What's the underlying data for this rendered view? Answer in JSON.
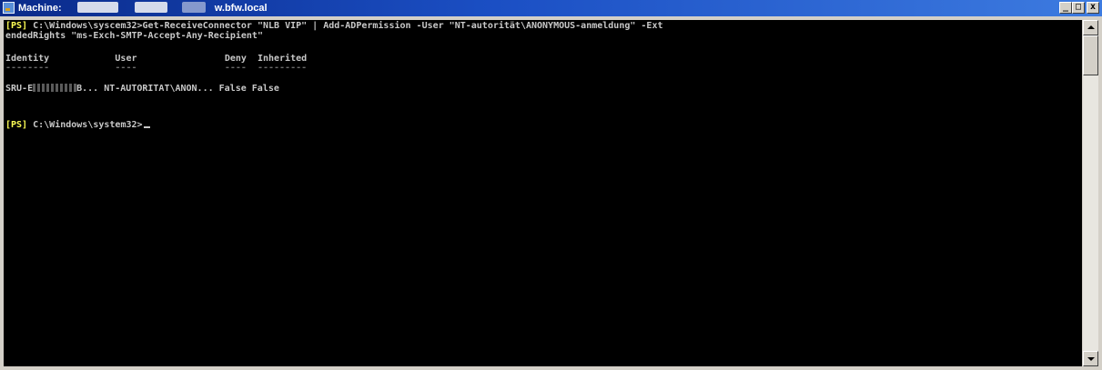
{
  "window": {
    "title_prefix": "Machine: ",
    "title_suffix": "w.bfw.local",
    "minimize_glyph": "_",
    "maximize_glyph": "□",
    "close_glyph": "x"
  },
  "console": {
    "prompt_tag": "[PS]",
    "line1_path": " C:\\Windows\\syscem32>",
    "line1_cmd": "Get-ReceiveConnector \"NLB VIP\" | Add-ADPermission -User \"NT-autorität\\ANONYMOUS-anmeldung\" -Ext",
    "line2": "endedRights \"ms-Exch-SMTP-Accept-Any-Recipient\"",
    "headers": "Identity            User                Deny  Inherited",
    "underline": "--------            ----                ----  ---------",
    "row_identity": "SRU-E",
    "row_rest": "B... NT-AUTORITAT\\ANON... False False",
    "prompt2_path": " C:\\Windows\\system32>"
  },
  "colors": {
    "console_bg": "#000000",
    "console_text": "#c8c8c8",
    "prompt": "#ffff55",
    "title_bar": "#1b4fc4"
  }
}
